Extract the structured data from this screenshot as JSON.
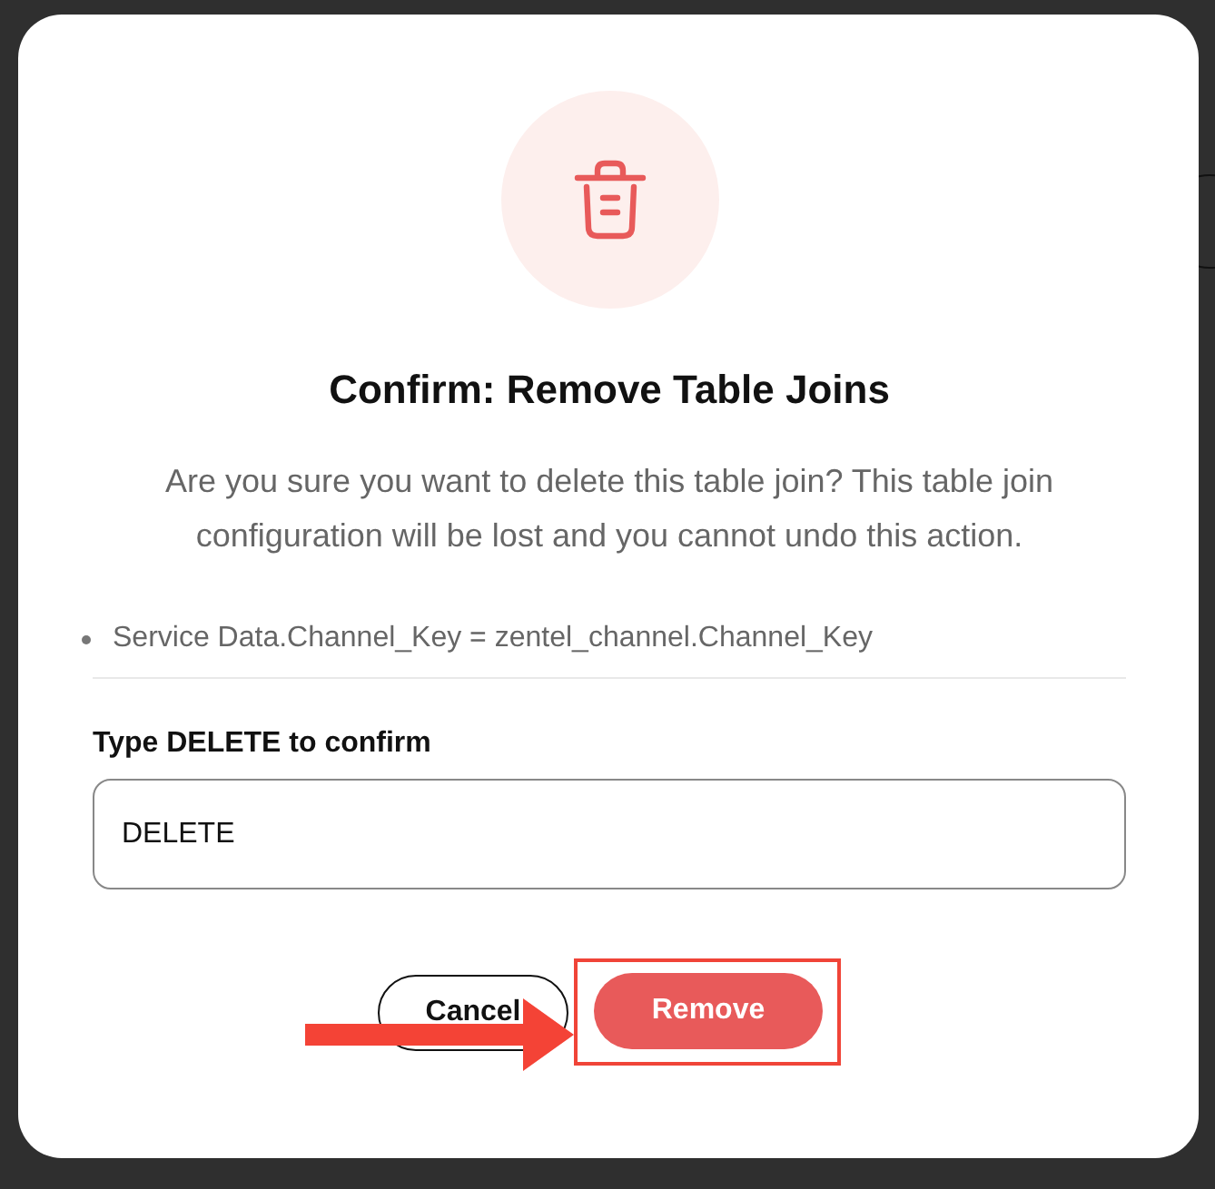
{
  "dialog": {
    "title": "Confirm: Remove Table Joins",
    "message": "Are you sure you want to delete this table join? This table join configuration will be lost and you cannot undo this action.",
    "items": [
      "Service Data.Channel_Key = zentel_channel.Channel_Key"
    ],
    "confirm_label": "Type DELETE to confirm",
    "confirm_input": {
      "value": "DELETE"
    },
    "buttons": [
      {
        "label": "Cancel",
        "kind": "secondary"
      },
      {
        "label": "Remove",
        "kind": "danger"
      }
    ]
  }
}
